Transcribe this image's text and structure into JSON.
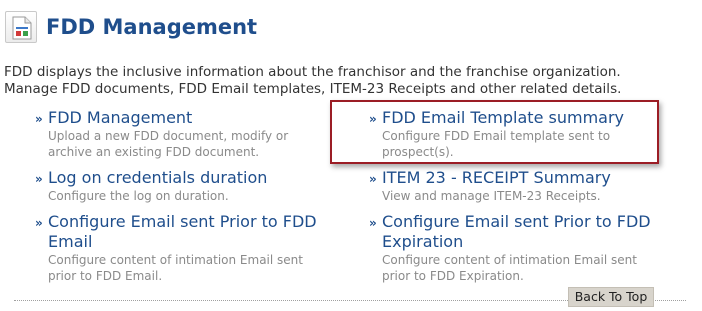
{
  "header": {
    "icon": "document-settings-icon",
    "title": "FDD Management"
  },
  "intro": {
    "line1": "FDD displays the inclusive information about the franchisor and the franchise organization.",
    "line2": "Manage FDD documents, FDD Email templates, ITEM-23 Receipts and other related details."
  },
  "items": [
    {
      "title": [
        "FDD Management"
      ],
      "desc": [
        "Upload a new FDD document, modify or",
        "archive an existing FDD document."
      ]
    },
    {
      "title": [
        "FDD Email Template summary"
      ],
      "desc": [
        "Configure FDD Email template sent to",
        "prospect(s)."
      ]
    },
    {
      "title": [
        "Log on credentials duration"
      ],
      "desc": [
        "Configure the log on duration."
      ]
    },
    {
      "title": [
        "ITEM 23 - RECEIPT Summary"
      ],
      "desc": [
        "View and manage ITEM-23 Receipts."
      ]
    },
    {
      "title": [
        "Configure Email sent Prior to FDD",
        "Email"
      ],
      "desc": [
        "Configure content of intimation Email sent",
        "prior to FDD Email."
      ]
    },
    {
      "title": [
        "Configure Email sent Prior to FDD",
        "Expiration"
      ],
      "desc": [
        "Configure content of intimation Email sent",
        "prior to FDD Expiration."
      ]
    }
  ],
  "bullet_glyph": "»",
  "footer": {
    "back_to_top": "Back To Top"
  },
  "colors": {
    "link": "#1f4e8c",
    "highlight": "#9b1d25",
    "button_bg": "#d8d4cc"
  }
}
